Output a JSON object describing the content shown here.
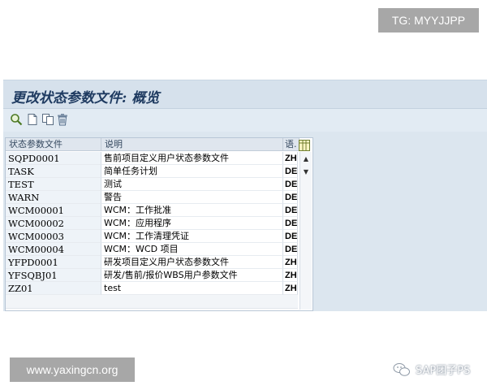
{
  "badges": {
    "top_right": "TG: MYYJJPP",
    "bottom_left": "www.yaxingcn.org"
  },
  "window": {
    "title": "更改状态参数文件: 概览"
  },
  "toolbar": {
    "icons": [
      "find-icon",
      "new-entry-icon",
      "copy-icon",
      "delete-icon"
    ]
  },
  "table": {
    "headers": {
      "key": "状态参数文件",
      "desc": "说明",
      "lang": "语."
    },
    "rows": [
      {
        "key": "SQPD0001",
        "desc": "售前项目定义用户状态参数文件",
        "lang": "ZH"
      },
      {
        "key": "TASK",
        "desc": "简单任务计划",
        "lang": "DE"
      },
      {
        "key": "TEST",
        "desc": "测试",
        "lang": "DE"
      },
      {
        "key": "WARN",
        "desc": "警告",
        "lang": "DE"
      },
      {
        "key": "WCM00001",
        "desc": "WCM：工作批准",
        "lang": "DE"
      },
      {
        "key": "WCM00002",
        "desc": "WCM：应用程序",
        "lang": "DE"
      },
      {
        "key": "WCM00003",
        "desc": "WCM：工作清理凭证",
        "lang": "DE"
      },
      {
        "key": "WCM00004",
        "desc": "WCM：WCD 项目",
        "lang": "DE"
      },
      {
        "key": "YFPD0001",
        "desc": "研发项目定义用户状态参数文件",
        "lang": "ZH"
      },
      {
        "key": "YFSQBJ01",
        "desc": "研发/售前/报价WBS用户参数文件",
        "lang": "ZH"
      },
      {
        "key": "ZZ01",
        "desc": "test",
        "lang": "ZH"
      }
    ]
  },
  "watermark": {
    "text": "SAP团子PS"
  },
  "colors": {
    "title": "#1f3b61",
    "window_bg": "#dce6ef",
    "badge_bg": "#a7a7a7"
  }
}
